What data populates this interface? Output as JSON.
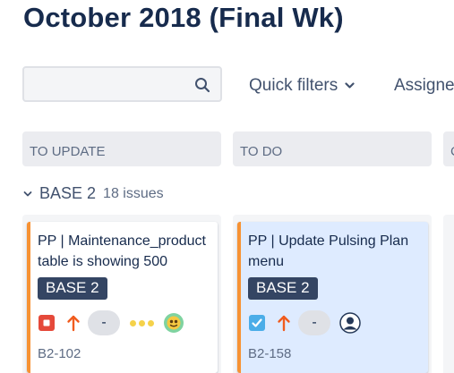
{
  "page": {
    "title": "October 2018 (Final Wk)"
  },
  "toolbar": {
    "search": {
      "value": "",
      "placeholder": ""
    },
    "quick_filters_label": "Quick filters",
    "assignee_label": "Assigne"
  },
  "columns": [
    {
      "label": "TO UPDATE"
    },
    {
      "label": "TO DO"
    },
    {
      "label": "C"
    }
  ],
  "swimlane": {
    "name": "BASE 2",
    "count": "18 issues",
    "expanded": true
  },
  "cards": [
    {
      "summary": "PP | Maintenance_product table is showing 500",
      "epic": "BASE 2",
      "issue_type_icon": "bug-icon",
      "priority_icon": "arrow-up-icon",
      "estimate": "-",
      "status_dots": "ellipsis-dots-icon",
      "assignee_icon": "avatar-emoji-icon",
      "key": "B2-102",
      "selected": false
    },
    {
      "summary": "PP | Update Pulsing Plan menu",
      "epic": "BASE 2",
      "issue_type_icon": "task-checkbox-icon",
      "priority_icon": "arrow-up-icon",
      "estimate": "-",
      "assignee_icon": "user-avatar-icon",
      "key": "B2-158",
      "selected": true
    }
  ],
  "colors": {
    "accent_flag": "#f79233",
    "epic_bg": "#344563",
    "bug_red": "#e5493a",
    "task_blue": "#4bade8",
    "priority_orange": "#f15c1e",
    "selected_card_bg": "#deebff",
    "avatar_blue": "#0052cc"
  }
}
